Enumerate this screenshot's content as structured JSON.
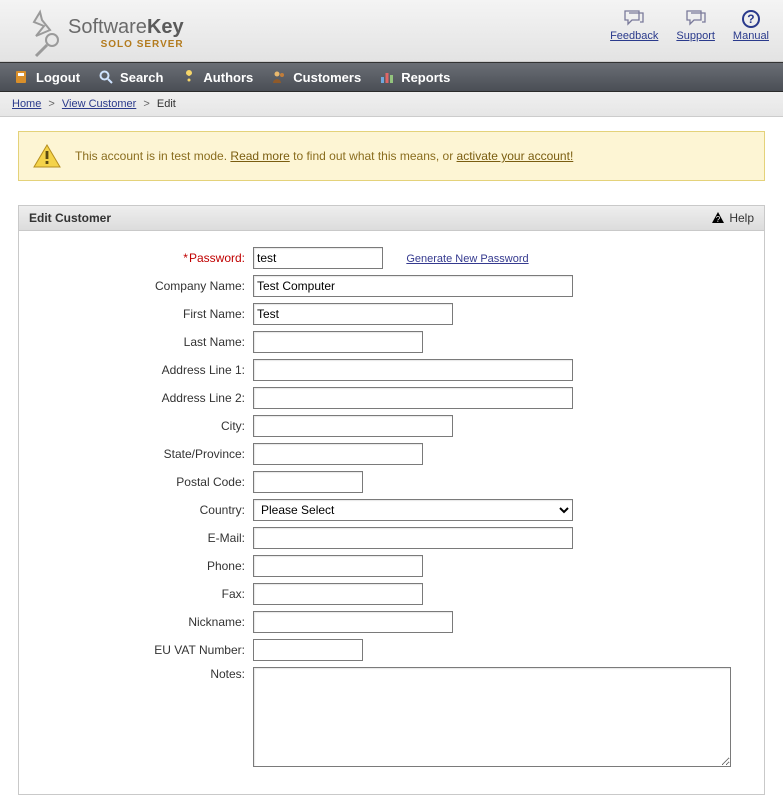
{
  "brand": {
    "soft": "Software",
    "key": "Key",
    "sub": "SOLO SERVER"
  },
  "top_links": {
    "feedback": "Feedback",
    "support": "Support",
    "manual": "Manual"
  },
  "nav": {
    "logout": "Logout",
    "search": "Search",
    "authors": "Authors",
    "customers": "Customers",
    "reports": "Reports"
  },
  "breadcrumb": {
    "home": "Home",
    "view_customer": "View Customer",
    "edit": "Edit"
  },
  "alert": {
    "prefix": "This account is in test mode. ",
    "read_more": "Read more",
    "middle": " to find out what this means, or ",
    "activate": "activate your account!"
  },
  "panel": {
    "title": "Edit Customer",
    "help": "Help"
  },
  "labels": {
    "password": "Password:",
    "company": "Company Name:",
    "first_name": "First Name:",
    "last_name": "Last Name:",
    "addr1": "Address Line 1:",
    "addr2": "Address Line 2:",
    "city": "City:",
    "state": "State/Province:",
    "postal": "Postal Code:",
    "country": "Country:",
    "email": "E-Mail:",
    "phone": "Phone:",
    "fax": "Fax:",
    "nickname": "Nickname:",
    "vat": "EU VAT Number:",
    "notes": "Notes:"
  },
  "values": {
    "password": "test",
    "company": "Test Computer",
    "first_name": "Test",
    "last_name": "",
    "addr1": "",
    "addr2": "",
    "city": "",
    "state": "",
    "postal": "",
    "country_selected": "Please Select",
    "email": "",
    "phone": "",
    "fax": "",
    "nickname": "",
    "vat": "",
    "notes": ""
  },
  "actions": {
    "gen_password": "Generate New Password"
  }
}
